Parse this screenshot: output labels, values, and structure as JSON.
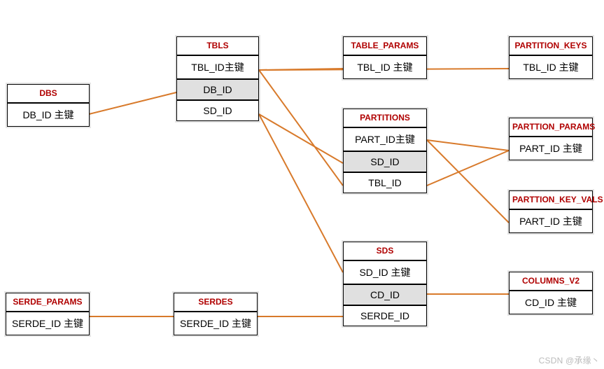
{
  "entities": {
    "dbs": {
      "title": "DBS",
      "rows": [
        "DB_ID 主键"
      ]
    },
    "tbls": {
      "title": "TBLS",
      "rows": [
        "TBL_ID主键",
        "DB_ID",
        "SD_ID"
      ]
    },
    "table_params": {
      "title": "TABLE_PARAMS",
      "rows": [
        "TBL_ID 主键"
      ]
    },
    "partition_keys": {
      "title": "PARTITION_KEYS",
      "rows": [
        "TBL_ID 主键"
      ]
    },
    "partitions": {
      "title": "PARTITIONS",
      "rows": [
        "PART_ID主键",
        "SD_ID",
        "TBL_ID"
      ]
    },
    "parttion_params": {
      "title": "PARTTION_PARAMS",
      "rows": [
        "PART_ID 主键"
      ]
    },
    "parttion_key_vals": {
      "title": "PARTTION_KEY_VALS",
      "rows": [
        "PART_ID 主键"
      ]
    },
    "sds": {
      "title": "SDS",
      "rows": [
        "SD_ID 主键",
        "CD_ID",
        "SERDE_ID"
      ]
    },
    "columns_v2": {
      "title": "COLUMNS_V2",
      "rows": [
        "CD_ID 主键"
      ]
    },
    "serdes": {
      "title": "SERDES",
      "rows": [
        "SERDE_ID 主键"
      ]
    },
    "serde_params": {
      "title": "SERDE_PARAMS",
      "rows": [
        "SERDE_ID 主键"
      ]
    }
  },
  "watermark": "CSDN @承缘丶"
}
